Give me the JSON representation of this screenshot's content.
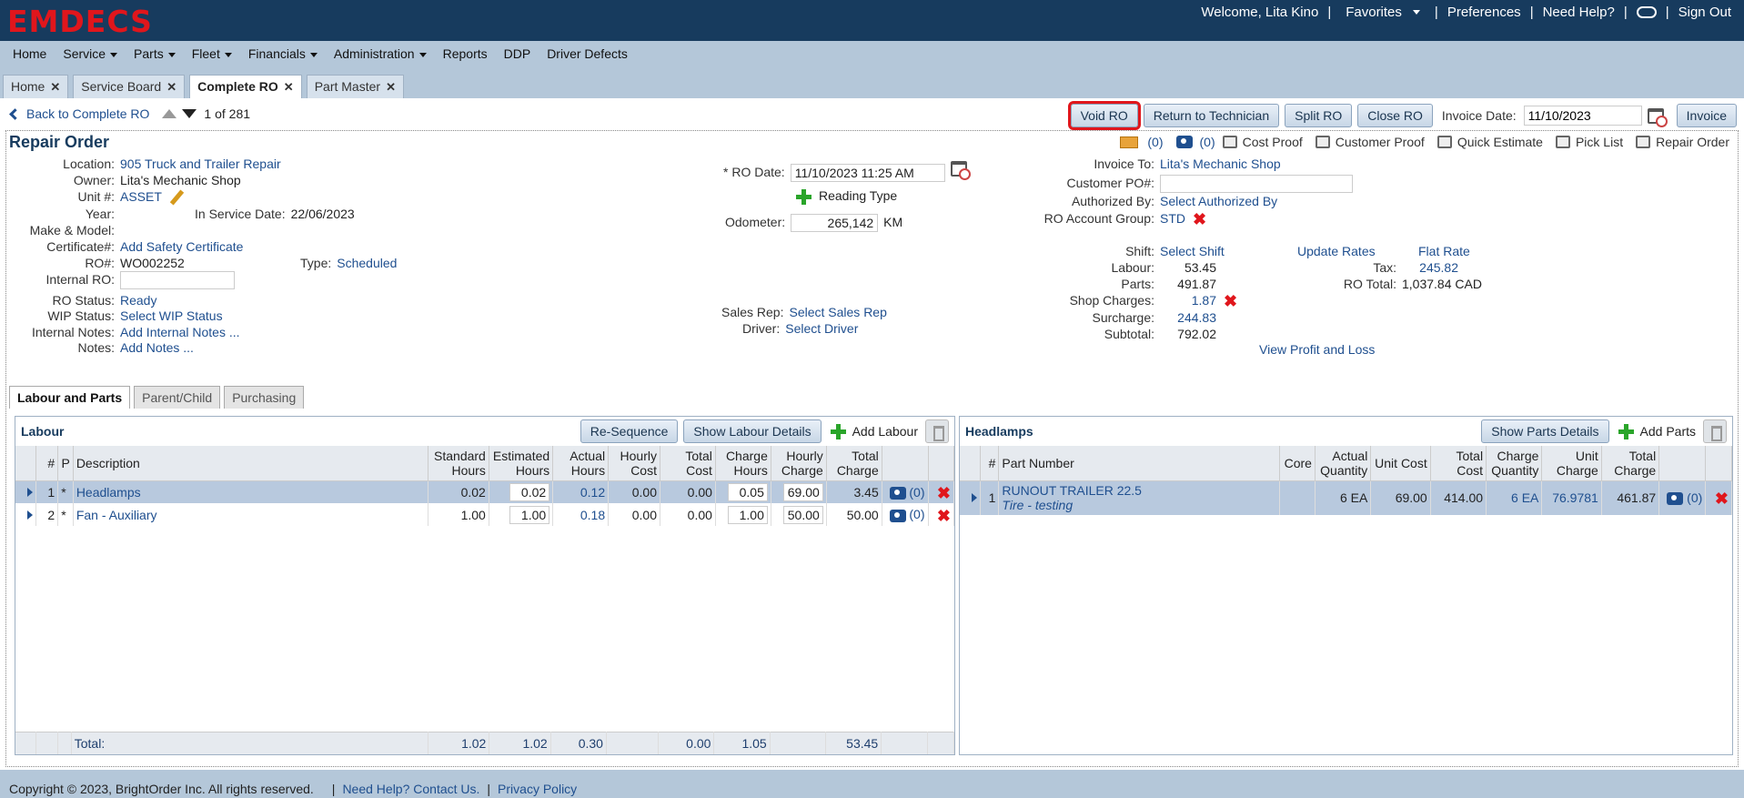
{
  "app": {
    "logo": "EMDECS"
  },
  "userbar": {
    "welcome": "Welcome, Lita Kino",
    "favorites": "Favorites",
    "preferences": "Preferences",
    "help": "Need Help?",
    "signout": "Sign Out"
  },
  "nav": [
    "Home",
    "Service",
    "Parts",
    "Fleet",
    "Financials",
    "Administration",
    "Reports",
    "DDP",
    "Driver Defects"
  ],
  "tabs": [
    "Home",
    "Service Board",
    "Complete RO",
    "Part Master"
  ],
  "back": {
    "label": "Back to Complete RO",
    "position": "1",
    "of": "of",
    "total": "281"
  },
  "actions": {
    "void": "Void RO",
    "return": "Return to Technician",
    "split": "Split RO",
    "close": "Close RO",
    "invoice_date_label": "Invoice Date:",
    "invoice_date": "11/10/2023",
    "invoice": "Invoice"
  },
  "quick_links": {
    "email_count": "(0)",
    "photo_count": "(0)",
    "cost_proof": "Cost Proof",
    "customer_proof": "Customer Proof",
    "quick_estimate": "Quick Estimate",
    "pick_list": "Pick List",
    "repair_order": "Repair Order"
  },
  "ro": {
    "title": "Repair Order",
    "location_label": "Location:",
    "location": "905 Truck and Trailer Repair",
    "owner_label": "Owner:",
    "owner": "Lita's Mechanic Shop",
    "unit_label": "Unit #:",
    "unit": "ASSET",
    "year_label": "Year:",
    "in_service_label": "In Service Date:",
    "in_service": "22/06/2023",
    "make_label": "Make & Model:",
    "cert_label": "Certificate#:",
    "cert": "Add Safety Certificate",
    "ro_no_label": "RO#:",
    "ro_no": "WO002252",
    "type_label": "Type:",
    "type": "Scheduled",
    "internal_ro_label": "Internal RO:",
    "status_label": "RO Status:",
    "status": "Ready",
    "wip_label": "WIP Status:",
    "wip": "Select WIP Status",
    "internal_notes_label": "Internal Notes:",
    "internal_notes": "Add Internal Notes ...",
    "notes_label": "Notes:",
    "notes": "Add Notes ...",
    "ro_date_label": "* RO Date:",
    "ro_date": "11/10/2023 11:25 AM",
    "reading_type": "Reading Type",
    "odometer_label": "Odometer:",
    "odometer": "265,142",
    "odometer_unit": "KM",
    "sales_rep_label": "Sales Rep:",
    "sales_rep": "Select Sales Rep",
    "driver_label": "Driver:",
    "driver": "Select Driver",
    "invoice_to_label": "Invoice To:",
    "invoice_to": "Lita's Mechanic Shop",
    "customer_po_label": "Customer PO#:",
    "authorized_label": "Authorized By:",
    "authorized": "Select Authorized By",
    "account_group_label": "RO Account Group:",
    "account_group": "STD",
    "shift_label": "Shift:",
    "shift": "Select Shift",
    "update_rates": "Update Rates",
    "flat_rate": "Flat Rate",
    "labour_label": "Labour:",
    "labour": "53.45",
    "tax_label": "Tax:",
    "tax": "245.82",
    "parts_label": "Parts:",
    "parts": "491.87",
    "ro_total_label": "RO Total:",
    "ro_total": "1,037.84 CAD",
    "shop_charges_label": "Shop Charges:",
    "shop_charges": "1.87",
    "surcharge_label": "Surcharge:",
    "surcharge": "244.83",
    "subtotal_label": "Subtotal:",
    "subtotal": "792.02",
    "profit_loss": "View Profit and Loss"
  },
  "subtabs": [
    "Labour and Parts",
    "Parent/Child",
    "Purchasing"
  ],
  "labour": {
    "title": "Labour",
    "resequence": "Re-Sequence",
    "show_details": "Show Labour Details",
    "add": "Add Labour",
    "headers": [
      "#",
      "P",
      "Description",
      "Standard Hours",
      "Estimated Hours",
      "Actual Hours",
      "Hourly Cost",
      "Total Cost",
      "Charge Hours",
      "Hourly Charge",
      "Total Charge"
    ],
    "rows": [
      {
        "num": "1",
        "p": "*",
        "desc": "Headlamps",
        "std": "0.02",
        "est": "0.02",
        "act": "0.12",
        "hcost": "0.00",
        "tcost": "0.00",
        "chrs": "0.05",
        "hchg": "69.00",
        "tchg": "3.45",
        "photos": "(0)"
      },
      {
        "num": "2",
        "p": "*",
        "desc": "Fan - Auxiliary",
        "std": "1.00",
        "est": "1.00",
        "act": "0.18",
        "hcost": "0.00",
        "tcost": "0.00",
        "chrs": "1.00",
        "hchg": "50.00",
        "tchg": "50.00",
        "photos": "(0)"
      }
    ],
    "total": {
      "label": "Total:",
      "std": "1.02",
      "est": "1.02",
      "act": "0.30",
      "tcost": "0.00",
      "chrs": "1.05",
      "tchg": "53.45"
    }
  },
  "parts": {
    "title": "Headlamps",
    "show_details": "Show Parts Details",
    "add": "Add Parts",
    "headers": [
      "#",
      "Part Number",
      "Core",
      "Actual Quantity",
      "Unit Cost",
      "Total Cost",
      "Charge Quantity",
      "Unit Charge",
      "Total Charge"
    ],
    "rows": [
      {
        "num": "1",
        "part": "RUNOUT TRAILER 22.5",
        "desc": "Tire - testing",
        "core": "",
        "aqty": "6 EA",
        "ucost": "69.00",
        "tcost": "414.00",
        "cqty": "6 EA",
        "uchg": "76.9781",
        "tchg": "461.87",
        "photos": "(0)"
      }
    ]
  },
  "footer": {
    "copyright": "Copyright © 2023, BrightOrder Inc. All rights reserved.",
    "help": "Need Help? Contact Us.",
    "privacy": "Privacy Policy"
  },
  "colors": {
    "header_bg": "#173b5e",
    "logo": "#e0161c",
    "link": "#1f4f8f",
    "highlight": "#e0161c"
  }
}
